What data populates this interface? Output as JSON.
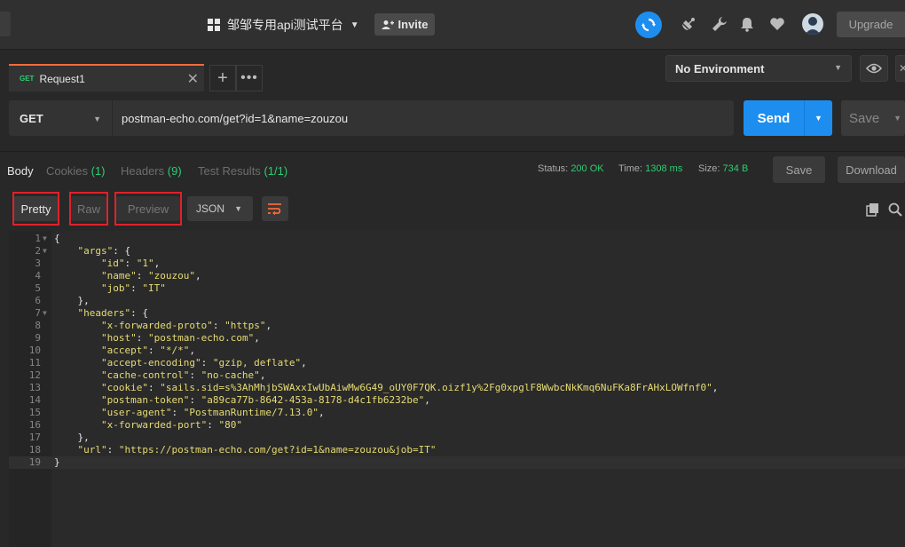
{
  "topbar": {
    "workspace": "邹邹专用api测试平台",
    "invite": "Invite",
    "upgrade": "Upgrade"
  },
  "tabs": {
    "request": {
      "method": "GET",
      "name": "Request1"
    },
    "environment": "No Environment"
  },
  "request": {
    "method": "GET",
    "url": "postman-echo.com/get?id=1&name=zouzou",
    "send": "Send",
    "save": "Save"
  },
  "response": {
    "tabs": {
      "body": "Body",
      "cookies": "Cookies",
      "cookies_count": "(1)",
      "headers": "Headers",
      "headers_count": "(9)",
      "tests": "Test Results",
      "tests_count": "(1/1)"
    },
    "status_label": "Status:",
    "status": "200 OK",
    "time_label": "Time:",
    "time": "1308 ms",
    "size_label": "Size:",
    "size": "734 B",
    "save": "Save",
    "download": "Download"
  },
  "format": {
    "pretty": "Pretty",
    "raw": "Raw",
    "preview": "Preview",
    "type": "JSON"
  },
  "code_lines": [
    "{",
    "    \"args\": {",
    "        \"id\": \"1\",",
    "        \"name\": \"zouzou\",",
    "        \"job\": \"IT\"",
    "    },",
    "    \"headers\": {",
    "        \"x-forwarded-proto\": \"https\",",
    "        \"host\": \"postman-echo.com\",",
    "        \"accept\": \"*/*\",",
    "        \"accept-encoding\": \"gzip, deflate\",",
    "        \"cache-control\": \"no-cache\",",
    "        \"cookie\": \"sails.sid=s%3AhMhjbSWAxxIwUbAiwMw6G49_oUY0F7QK.oizf1y%2Fg0xpglF8WwbcNkKmq6NuFKa8FrAHxLOWfnf0\",",
    "        \"postman-token\": \"a89ca77b-8642-453a-8178-d4c1fb6232be\",",
    "        \"user-agent\": \"PostmanRuntime/7.13.0\",",
    "        \"x-forwarded-port\": \"80\"",
    "    },",
    "    \"url\": \"https://postman-echo.com/get?id=1&name=zouzou&job=IT\"",
    "}"
  ],
  "colors": {
    "accent_blue": "#1d8ef0",
    "tab_orange": "#f26b3a",
    "status_green": "#2ecc71",
    "highlight_red": "#e0212b",
    "json_string": "#e6db74"
  }
}
